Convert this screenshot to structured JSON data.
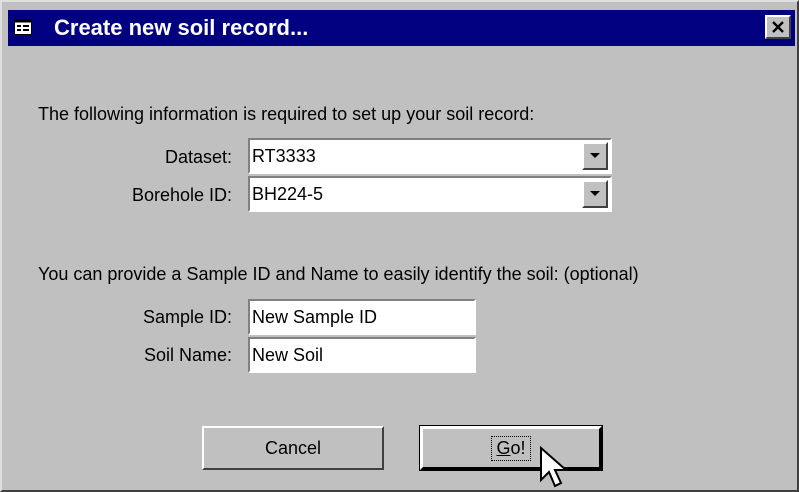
{
  "window": {
    "title": "Create new soil record...",
    "close_glyph": "×"
  },
  "required_section": {
    "intro": "The following information is required to set up your soil record:",
    "dataset_label": "Dataset:",
    "dataset_value": "RT3333",
    "borehole_label": "Borehole ID:",
    "borehole_value": "BH224-5"
  },
  "optional_section": {
    "intro": "You can provide a Sample ID and Name to easily identify the soil: (optional)",
    "sample_id_label": "Sample ID:",
    "sample_id_value": "New Sample ID",
    "soil_name_label": "Soil Name:",
    "soil_name_value": "New Soil"
  },
  "buttons": {
    "cancel": "Cancel",
    "go_accel": "G",
    "go_rest": "o!"
  },
  "icons": {
    "title": "form-icon",
    "close": "close-icon",
    "dropdown": "chevron-down-icon",
    "cursor": "mouse-pointer-icon"
  },
  "colors": {
    "titlebar": "#000080",
    "face": "#c0c0c0",
    "field": "#ffffff"
  }
}
